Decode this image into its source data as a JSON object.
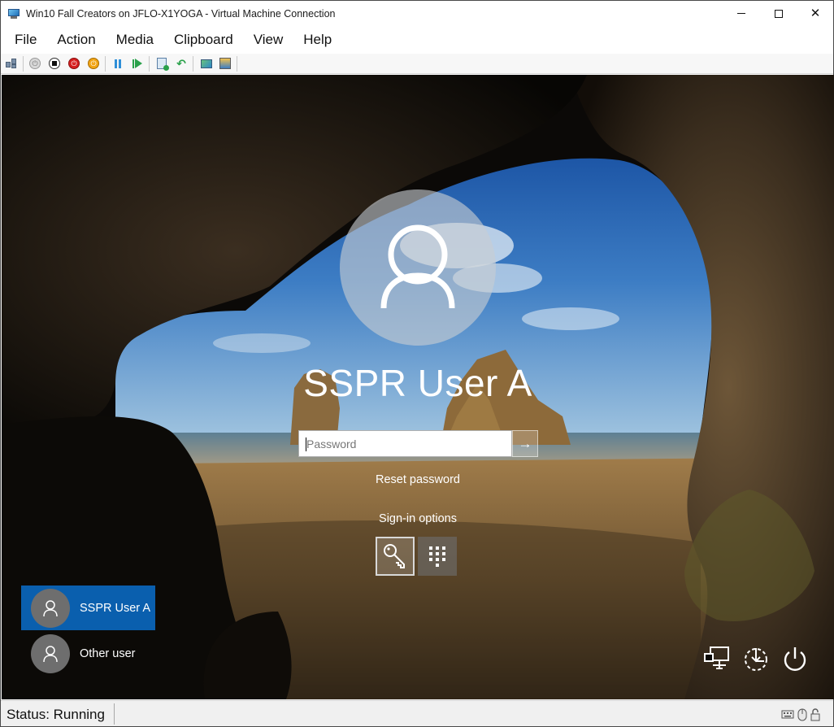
{
  "window": {
    "title": "Win10 Fall Creators on JFLO-X1YOGA - Virtual Machine Connection",
    "controls": {
      "minimize": "minimize",
      "maximize": "maximize",
      "close": "✕"
    }
  },
  "menu": [
    "File",
    "Action",
    "Media",
    "Clipboard",
    "View",
    "Help"
  ],
  "toolbar": {
    "buttons": [
      "ctrl-alt-del-icon",
      "start-icon",
      "turn-off-icon",
      "shut-down-icon",
      "save-icon",
      "pause-icon",
      "resume-icon",
      "checkpoint-icon",
      "revert-icon",
      "enhanced-session-icon",
      "share-icon"
    ]
  },
  "login": {
    "username": "SSPR User A",
    "password_placeholder": "Password",
    "password_value": "",
    "submit_arrow": "→",
    "reset_password": "Reset password",
    "signin_options": "Sign-in options",
    "options": [
      "password-key-icon",
      "pin-icon"
    ],
    "users": [
      {
        "name": "SSPR User A",
        "selected": true
      },
      {
        "name": "Other user",
        "selected": false
      }
    ],
    "system_buttons": [
      "network-icon",
      "ease-of-access-icon",
      "power-icon"
    ]
  },
  "statusbar": {
    "status": "Status: Running",
    "indicators": [
      "keyboard-icon",
      "mouse-icon",
      "lock-icon"
    ]
  },
  "colors": {
    "selected_user_tile": "#0a5fae",
    "sky": "#2b6fc0",
    "sand": "#8a6a3f"
  }
}
